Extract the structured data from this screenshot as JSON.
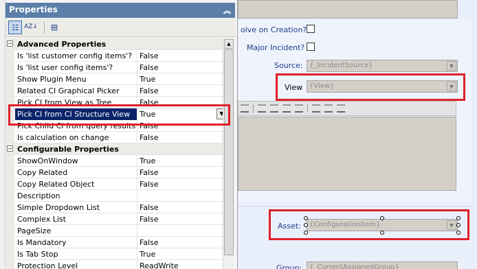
{
  "properties_pane": {
    "title": "Properties",
    "collapse_icon": "double-chevron-up-icon",
    "toolbar": {
      "categorized_icon": "categorized-icon",
      "alphabetical_label": "AZ↓",
      "property_pages_icon": "property-pages-icon"
    },
    "categories": [
      {
        "label": "Advanced Properties",
        "toggle": "−",
        "rows": [
          {
            "name": "Is 'list customer config items'?",
            "value": "False"
          },
          {
            "name": "Is 'list user config items'?",
            "value": "False"
          },
          {
            "name": "Show Plugin Menu",
            "value": "True"
          },
          {
            "name": "Related CI Graphical Picker",
            "value": "False"
          },
          {
            "name": "Pick CI from View as Tree",
            "value": "False"
          },
          {
            "name": "Pick CI from CI Structure View",
            "value": "True"
          },
          {
            "name": "Pick Child CI from query results",
            "value": "False"
          },
          {
            "name": "Is calculation on change",
            "value": "False"
          }
        ]
      },
      {
        "label": "Configurable Properties",
        "toggle": "−",
        "rows": [
          {
            "name": "ShowOnWindow",
            "value": "True"
          },
          {
            "name": "Copy Related",
            "value": "False"
          },
          {
            "name": "Copy Related Object",
            "value": "False"
          },
          {
            "name": "Description",
            "value": ""
          },
          {
            "name": "Simple Dropdown List",
            "value": "False"
          },
          {
            "name": "Complex List",
            "value": "False"
          },
          {
            "name": "PageSize",
            "value": ""
          },
          {
            "name": "Is Mandatory",
            "value": "False"
          },
          {
            "name": "Is Tab Stop",
            "value": "True"
          },
          {
            "name": "Protection Level",
            "value": "ReadWrite"
          }
        ]
      }
    ]
  },
  "form": {
    "solve_on_creation_label": "olve on Creation?",
    "major_incident_label": "Major Incident?",
    "source_label": "Source:",
    "source_value": "{_IncidentSource}",
    "view_label": "View",
    "view_value": "{View}",
    "asset_label": "Asset:",
    "asset_value": "{ConfigurationItem}",
    "group_label": "Group:",
    "group_value": "{_CurrentAssignedGroup}"
  },
  "colors": {
    "highlight_box": "#e0202a",
    "selected_row": "#0a246a",
    "title_bar": "#5b7fa8",
    "form_label": "#1f3d8a"
  }
}
